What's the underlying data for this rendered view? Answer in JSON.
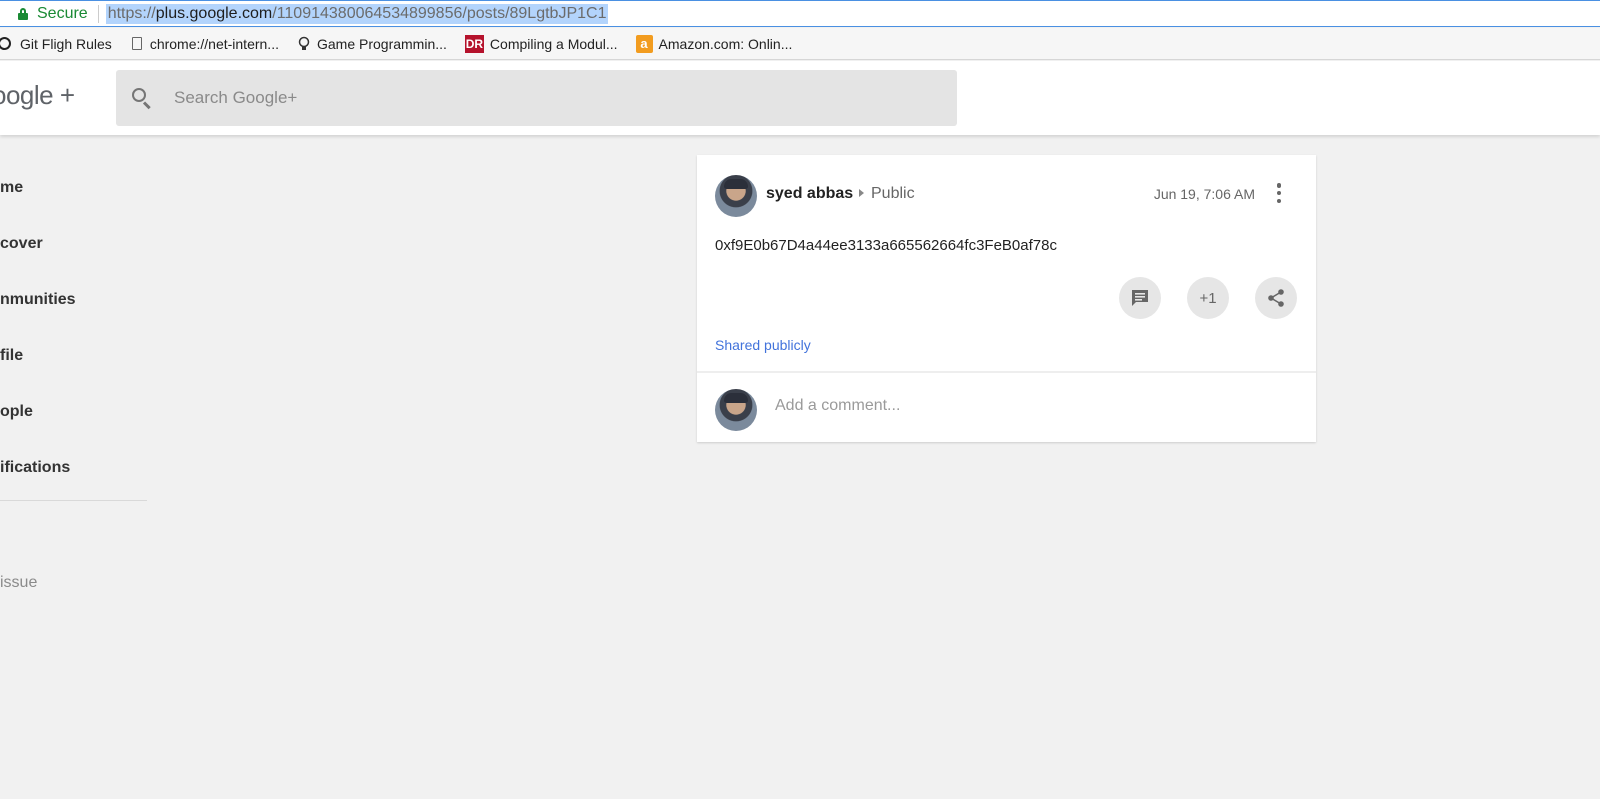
{
  "browser": {
    "secure_label": "Secure",
    "url_scheme": "https://",
    "url_host": "plus.google.com",
    "url_path": "/110914380064534899856/posts/89LgtbJP1C1",
    "bookmarks": [
      {
        "label": "Git Fligh Rules",
        "icon": "github-icon"
      },
      {
        "label": "chrome://net-intern...",
        "icon": "page-icon"
      },
      {
        "label": "Game Programmin...",
        "icon": "lightbulb-icon"
      },
      {
        "label": "Compiling a Modul...",
        "icon": "dr-icon",
        "icon_text": "DR"
      },
      {
        "label": "Amazon.com: Onlin...",
        "icon": "amazon-icon",
        "icon_text": "a"
      }
    ]
  },
  "header": {
    "logo": "oogle +",
    "search_placeholder": "Search Google+"
  },
  "sidebar": {
    "items": [
      "me",
      "cover",
      "nmunities",
      "file",
      "ople",
      "ifications"
    ],
    "footer": "issue"
  },
  "post": {
    "author": "syed abbas",
    "visibility": "Public",
    "timestamp": "Jun 19, 7:06 AM",
    "content": "0xf9E0b67D4a44ee3133a665562664fc3FeB0af78c",
    "plus_one_label": "+1",
    "shared_label": "Shared publicly",
    "comment_placeholder": "Add a comment..."
  },
  "colors": {
    "secure_green": "#1a8a34",
    "link_blue": "#4273db",
    "url_selection": "#b3d4fc"
  }
}
